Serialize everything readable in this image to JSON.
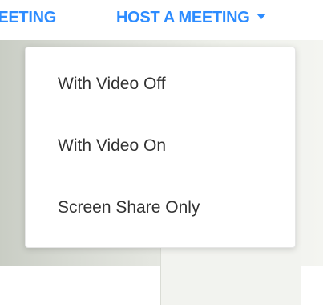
{
  "nav": {
    "left_label": "JOIN A MEETING",
    "host_label": "HOST A MEETING",
    "host_icon": "caret-down-icon",
    "accent_color": "#2D8CFF"
  },
  "dropdown": {
    "items": [
      {
        "label": "With Video Off"
      },
      {
        "label": "With Video On"
      },
      {
        "label": "Screen Share Only"
      }
    ]
  }
}
